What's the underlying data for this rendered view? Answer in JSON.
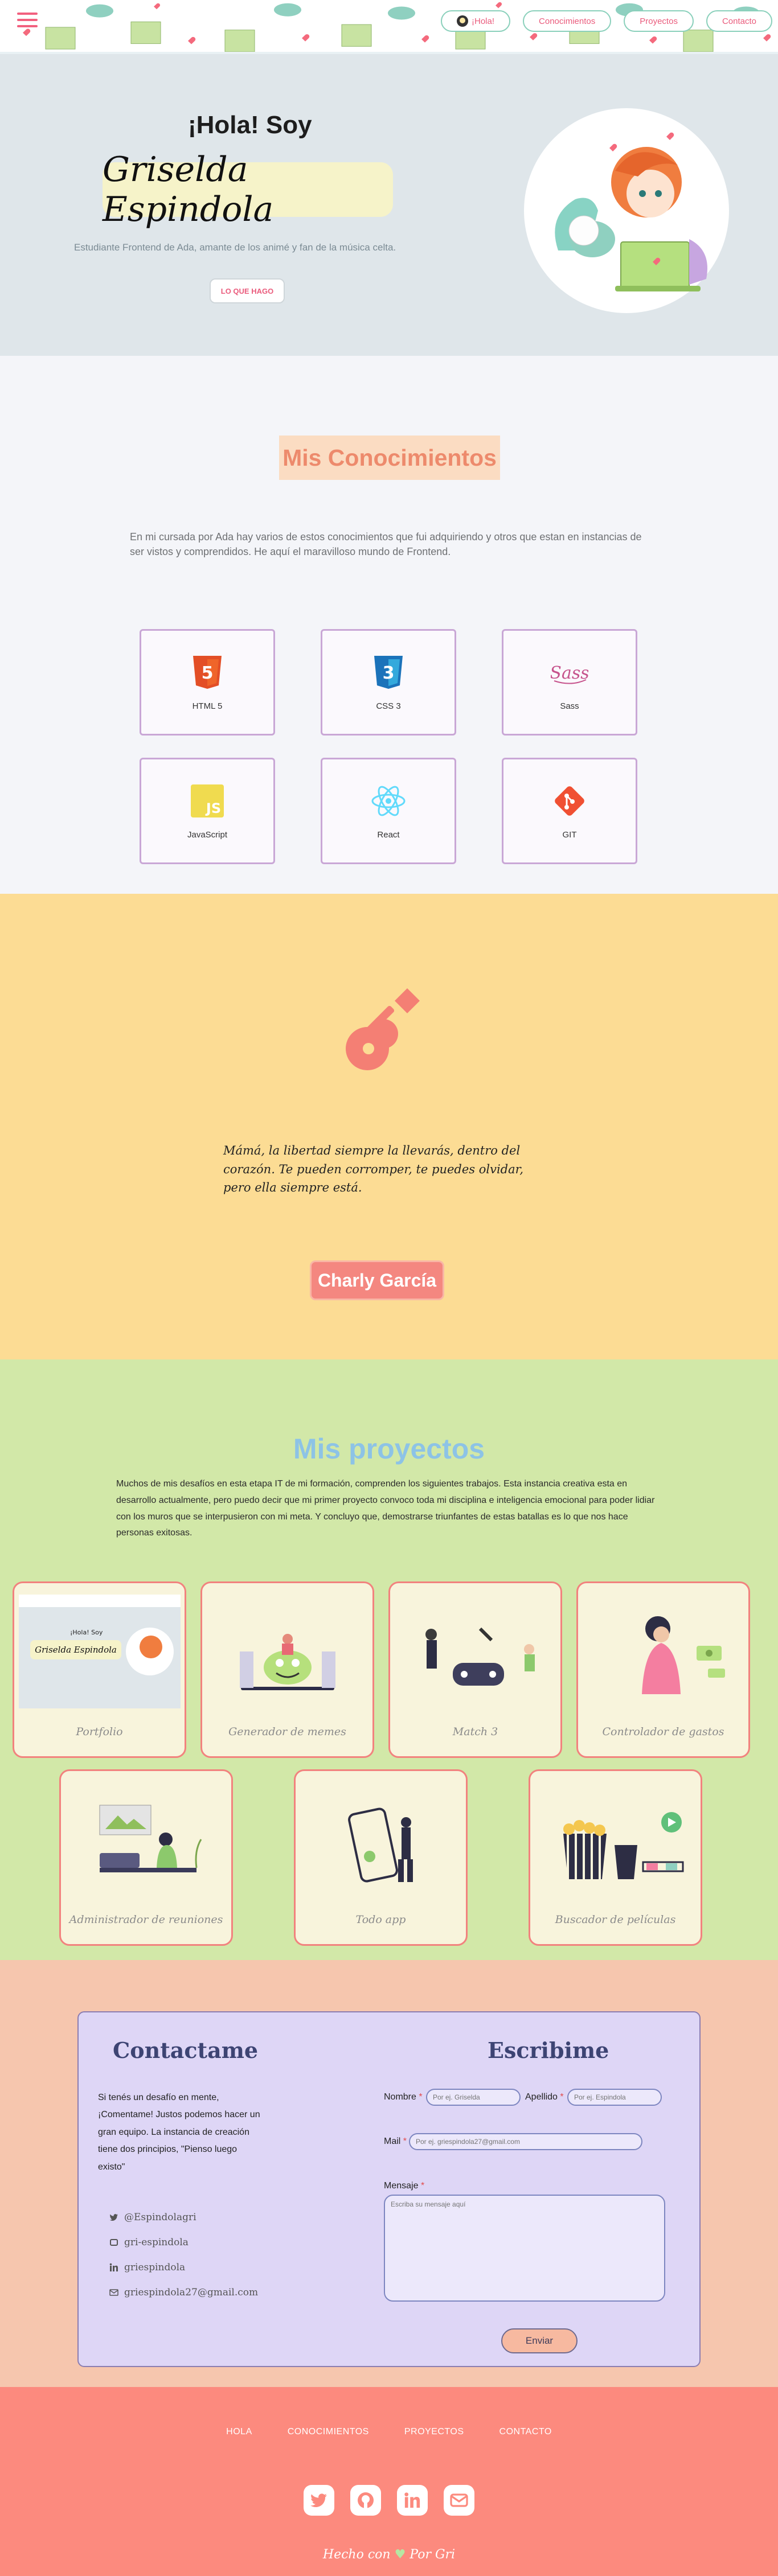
{
  "nav": {
    "menu_icon": "hamburger-icon",
    "links": [
      "¡Hola!",
      "Conocimientos",
      "Proyectos",
      "Contacto"
    ]
  },
  "hero": {
    "greeting": "¡Hola! Soy",
    "name": "Griselda Espindola",
    "subtitle": "Estudiante Frontend de Ada, amante de los animé y fan de la música celta.",
    "cta": "LO QUE HAGO"
  },
  "skills": {
    "title": "Mis Conocimientos",
    "description": "En mi cursada por Ada hay varios de estos conocimientos que fui adquiriendo y otros que estan en instancias de ser vistos y comprendidos. He aquí el maravilloso mundo de Frontend.",
    "items": [
      {
        "label": "HTML 5",
        "icon": "html5-icon",
        "color": "#e34f26"
      },
      {
        "label": "CSS 3",
        "icon": "css3-icon",
        "color": "#1b73ba"
      },
      {
        "label": "Sass",
        "icon": "sass-icon",
        "color": "#c6538c"
      },
      {
        "label": "JavaScript",
        "icon": "javascript-icon",
        "color": "#f0db4f"
      },
      {
        "label": "React",
        "icon": "react-icon",
        "color": "#61dafb"
      },
      {
        "label": "GIT",
        "icon": "git-icon",
        "color": "#f05033"
      }
    ]
  },
  "quote": {
    "text": "Mámá, la libertad siempre la llevarás, dentro del corazón. Te pueden corromper, te puedes olvidar, pero ella siempre está.",
    "author": "Charly García"
  },
  "projects": {
    "title": "Mis proyectos",
    "description": "Muchos de mis desafíos en esta etapa IT de mi formación, comprenden los siguientes trabajos. Esta instancia creativa esta en desarrollo actualmente, pero puedo decir que mi primer proyecto convoco toda mi disciplina e inteligencia emocional para poder lidiar con los muros que se interpusieron con mi meta. Y concluyo que, demostrarse triunfantes de estas batallas es lo que nos hace personas exitosas.",
    "items": [
      {
        "title": "Portfolio"
      },
      {
        "title": "Generador de memes"
      },
      {
        "title": "Match 3"
      },
      {
        "title": "Controlador de gastos"
      },
      {
        "title": "Administrador de reuniones"
      },
      {
        "title": "Todo app"
      },
      {
        "title": "Buscador de películas"
      }
    ],
    "thumb_mini_name": "Griselda Espindola",
    "thumb_mini_greeting": "¡Hola! Soy"
  },
  "contact": {
    "title_left": "Contactame",
    "title_right": "Escribime",
    "intro": "Si tenés un desafío en mente, ¡Comentame! Justos podemos hacer un gran equipo. La instancia de creación tiene dos principios, \"Pienso luego existo\"",
    "social": [
      {
        "icon": "twitter-icon",
        "text": "@Espindolagri"
      },
      {
        "icon": "github-icon",
        "text": "gri-espindola"
      },
      {
        "icon": "linkedin-icon",
        "text": "griespindola"
      },
      {
        "icon": "email-icon",
        "text": "griespindola27@gmail.com"
      }
    ],
    "form": {
      "name_label": "Nombre",
      "name_placeholder": "Por ej. Griselda",
      "surname_label": "Apellido",
      "surname_placeholder": "Por ej. Espindola",
      "mail_label": "Mail",
      "mail_placeholder": "Por ej. griespindola27@gmail.com",
      "message_label": "Mensaje",
      "message_placeholder": "Escriba su mensaje aquí",
      "required_mark": "*",
      "send": "Enviar"
    }
  },
  "footer": {
    "links": [
      "HOLA",
      "CONOCIMIENTOS",
      "PROYECTOS",
      "CONTACTO"
    ],
    "icons": [
      "twitter-icon",
      "github-icon",
      "linkedin-icon",
      "email-icon"
    ],
    "credit_before": "Hecho con",
    "credit_heart": "♥",
    "credit_after": "Por Gri"
  },
  "colors": {
    "accent_pink": "#ea5b7c",
    "hero_bg": "#dfe6ea",
    "skills_bg": "#f4f5f9",
    "quote_bg": "#fcdc94",
    "projects_bg": "#d2e8a8",
    "contact_bg": "#f6c6ae",
    "footer_bg": "#fc8a7e"
  }
}
